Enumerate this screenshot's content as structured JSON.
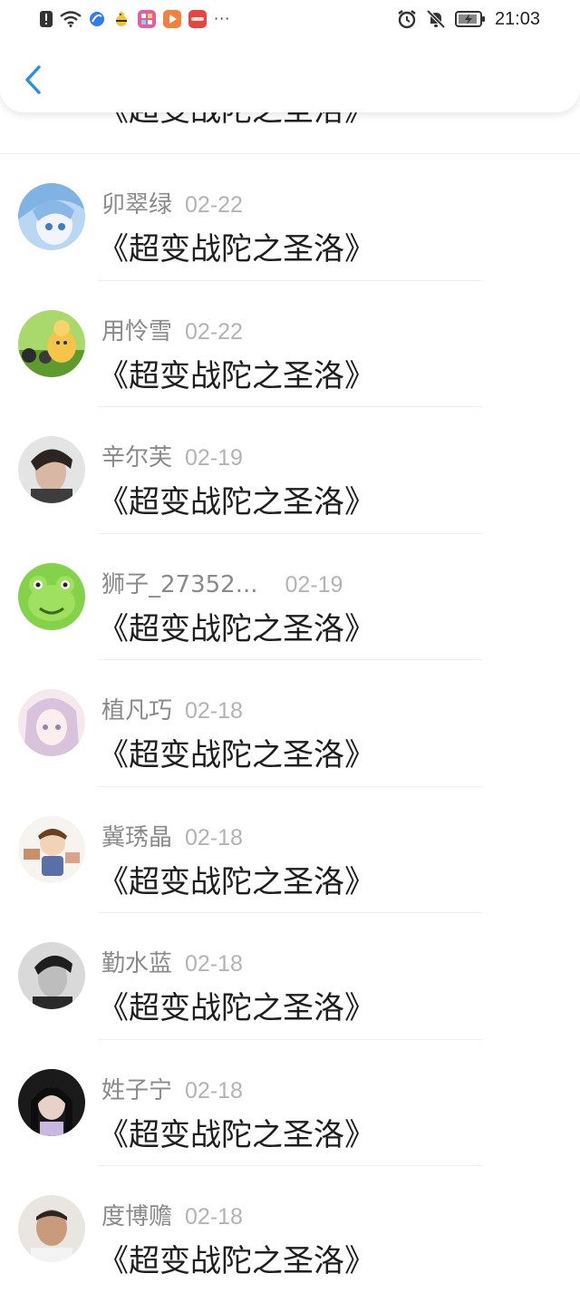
{
  "status_bar": {
    "time": "21:03",
    "more": "···",
    "left_icons": [
      "warning-icon",
      "wifi-icon",
      "browser-icon",
      "bee-app-icon",
      "app-icon-pink",
      "video-app-icon",
      "news-app-icon"
    ],
    "right_icons": [
      "alarm-icon",
      "mute-icon",
      "battery-icon"
    ],
    "colors": {
      "browser": "#2f7cf6",
      "app_pink": "#e95b9a",
      "video_app": "#f5803e",
      "news_app": "#e8453c"
    }
  },
  "nav": {
    "back_icon": "chevron-left-icon",
    "accent": "#2a8cf0"
  },
  "comments": [
    {
      "name": "",
      "date": "",
      "text": "《超变战陀之圣洛》"
    },
    {
      "name": "卯翠绿",
      "date": "02-22",
      "text": "《超变战陀之圣洛》"
    },
    {
      "name": "用怜雪",
      "date": "02-22",
      "text": "《超变战陀之圣洛》"
    },
    {
      "name": "辛尔芙",
      "date": "02-19",
      "text": "《超变战陀之圣洛》"
    },
    {
      "name": "狮子_27352...",
      "date": "02-19",
      "text": "《超变战陀之圣洛》"
    },
    {
      "name": "植凡巧",
      "date": "02-18",
      "text": "《超变战陀之圣洛》"
    },
    {
      "name": "冀琇晶",
      "date": "02-18",
      "text": "《超变战陀之圣洛》"
    },
    {
      "name": "勤水蓝",
      "date": "02-18",
      "text": "《超变战陀之圣洛》"
    },
    {
      "name": "姓子宁",
      "date": "02-18",
      "text": "《超变战陀之圣洛》"
    },
    {
      "name": "度博赡",
      "date": "02-18",
      "text": "《超变战陀之圣洛》"
    }
  ]
}
